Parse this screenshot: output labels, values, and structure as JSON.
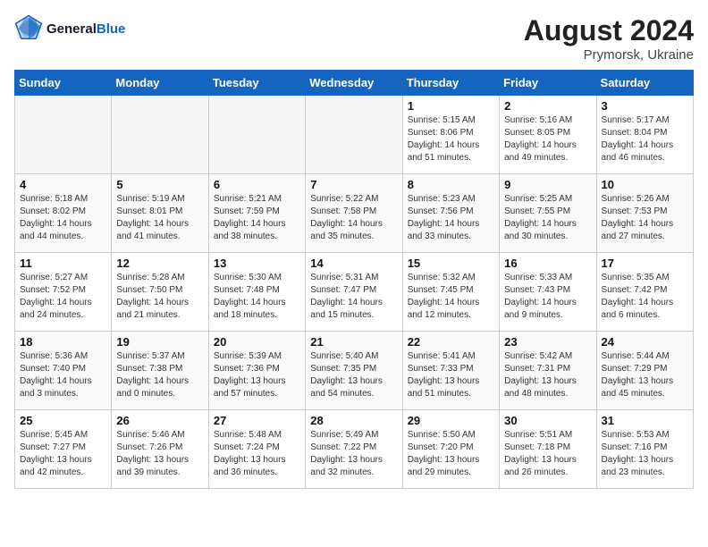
{
  "header": {
    "logo_text_1": "General",
    "logo_text_2": "Blue",
    "month_year": "August 2024",
    "location": "Prymorsk, Ukraine"
  },
  "days_of_week": [
    "Sunday",
    "Monday",
    "Tuesday",
    "Wednesday",
    "Thursday",
    "Friday",
    "Saturday"
  ],
  "weeks": [
    [
      {
        "num": "",
        "info": ""
      },
      {
        "num": "",
        "info": ""
      },
      {
        "num": "",
        "info": ""
      },
      {
        "num": "",
        "info": ""
      },
      {
        "num": "1",
        "info": "Sunrise: 5:15 AM\nSunset: 8:06 PM\nDaylight: 14 hours\nand 51 minutes."
      },
      {
        "num": "2",
        "info": "Sunrise: 5:16 AM\nSunset: 8:05 PM\nDaylight: 14 hours\nand 49 minutes."
      },
      {
        "num": "3",
        "info": "Sunrise: 5:17 AM\nSunset: 8:04 PM\nDaylight: 14 hours\nand 46 minutes."
      }
    ],
    [
      {
        "num": "4",
        "info": "Sunrise: 5:18 AM\nSunset: 8:02 PM\nDaylight: 14 hours\nand 44 minutes."
      },
      {
        "num": "5",
        "info": "Sunrise: 5:19 AM\nSunset: 8:01 PM\nDaylight: 14 hours\nand 41 minutes."
      },
      {
        "num": "6",
        "info": "Sunrise: 5:21 AM\nSunset: 7:59 PM\nDaylight: 14 hours\nand 38 minutes."
      },
      {
        "num": "7",
        "info": "Sunrise: 5:22 AM\nSunset: 7:58 PM\nDaylight: 14 hours\nand 35 minutes."
      },
      {
        "num": "8",
        "info": "Sunrise: 5:23 AM\nSunset: 7:56 PM\nDaylight: 14 hours\nand 33 minutes."
      },
      {
        "num": "9",
        "info": "Sunrise: 5:25 AM\nSunset: 7:55 PM\nDaylight: 14 hours\nand 30 minutes."
      },
      {
        "num": "10",
        "info": "Sunrise: 5:26 AM\nSunset: 7:53 PM\nDaylight: 14 hours\nand 27 minutes."
      }
    ],
    [
      {
        "num": "11",
        "info": "Sunrise: 5:27 AM\nSunset: 7:52 PM\nDaylight: 14 hours\nand 24 minutes."
      },
      {
        "num": "12",
        "info": "Sunrise: 5:28 AM\nSunset: 7:50 PM\nDaylight: 14 hours\nand 21 minutes."
      },
      {
        "num": "13",
        "info": "Sunrise: 5:30 AM\nSunset: 7:48 PM\nDaylight: 14 hours\nand 18 minutes."
      },
      {
        "num": "14",
        "info": "Sunrise: 5:31 AM\nSunset: 7:47 PM\nDaylight: 14 hours\nand 15 minutes."
      },
      {
        "num": "15",
        "info": "Sunrise: 5:32 AM\nSunset: 7:45 PM\nDaylight: 14 hours\nand 12 minutes."
      },
      {
        "num": "16",
        "info": "Sunrise: 5:33 AM\nSunset: 7:43 PM\nDaylight: 14 hours\nand 9 minutes."
      },
      {
        "num": "17",
        "info": "Sunrise: 5:35 AM\nSunset: 7:42 PM\nDaylight: 14 hours\nand 6 minutes."
      }
    ],
    [
      {
        "num": "18",
        "info": "Sunrise: 5:36 AM\nSunset: 7:40 PM\nDaylight: 14 hours\nand 3 minutes."
      },
      {
        "num": "19",
        "info": "Sunrise: 5:37 AM\nSunset: 7:38 PM\nDaylight: 14 hours\nand 0 minutes."
      },
      {
        "num": "20",
        "info": "Sunrise: 5:39 AM\nSunset: 7:36 PM\nDaylight: 13 hours\nand 57 minutes."
      },
      {
        "num": "21",
        "info": "Sunrise: 5:40 AM\nSunset: 7:35 PM\nDaylight: 13 hours\nand 54 minutes."
      },
      {
        "num": "22",
        "info": "Sunrise: 5:41 AM\nSunset: 7:33 PM\nDaylight: 13 hours\nand 51 minutes."
      },
      {
        "num": "23",
        "info": "Sunrise: 5:42 AM\nSunset: 7:31 PM\nDaylight: 13 hours\nand 48 minutes."
      },
      {
        "num": "24",
        "info": "Sunrise: 5:44 AM\nSunset: 7:29 PM\nDaylight: 13 hours\nand 45 minutes."
      }
    ],
    [
      {
        "num": "25",
        "info": "Sunrise: 5:45 AM\nSunset: 7:27 PM\nDaylight: 13 hours\nand 42 minutes."
      },
      {
        "num": "26",
        "info": "Sunrise: 5:46 AM\nSunset: 7:26 PM\nDaylight: 13 hours\nand 39 minutes."
      },
      {
        "num": "27",
        "info": "Sunrise: 5:48 AM\nSunset: 7:24 PM\nDaylight: 13 hours\nand 36 minutes."
      },
      {
        "num": "28",
        "info": "Sunrise: 5:49 AM\nSunset: 7:22 PM\nDaylight: 13 hours\nand 32 minutes."
      },
      {
        "num": "29",
        "info": "Sunrise: 5:50 AM\nSunset: 7:20 PM\nDaylight: 13 hours\nand 29 minutes."
      },
      {
        "num": "30",
        "info": "Sunrise: 5:51 AM\nSunset: 7:18 PM\nDaylight: 13 hours\nand 26 minutes."
      },
      {
        "num": "31",
        "info": "Sunrise: 5:53 AM\nSunset: 7:16 PM\nDaylight: 13 hours\nand 23 minutes."
      }
    ]
  ]
}
